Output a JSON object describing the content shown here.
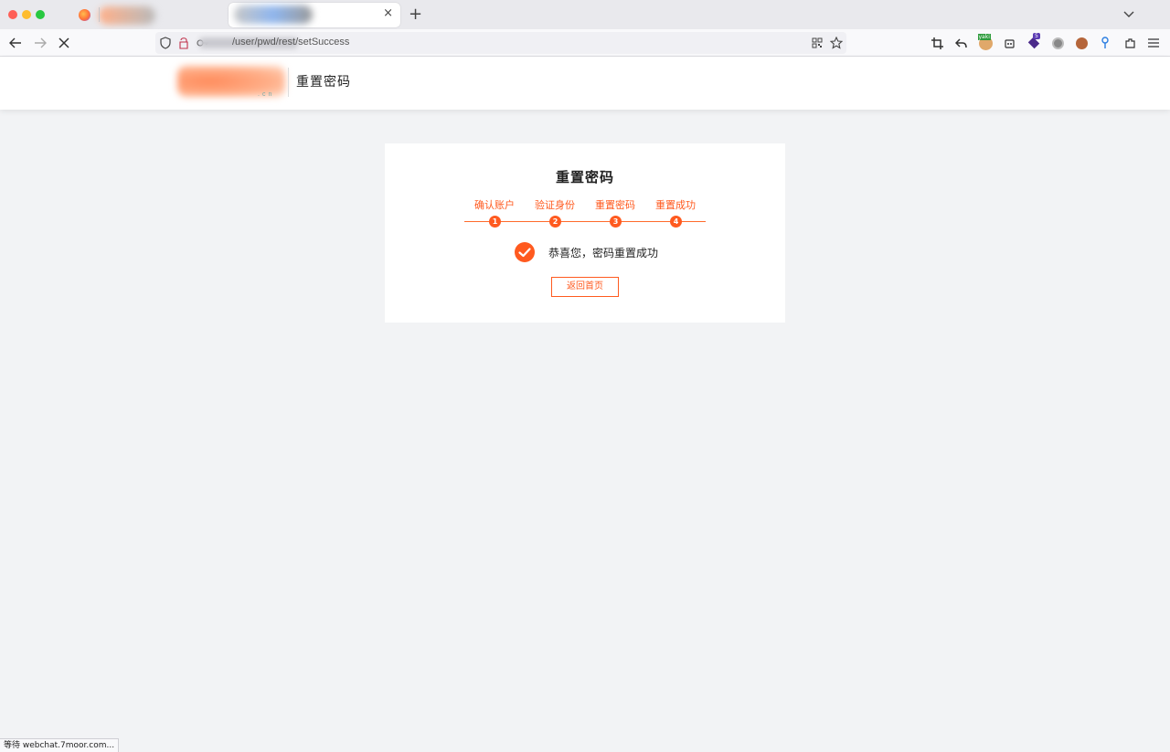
{
  "browser": {
    "url_path": "/user/pwd/rest/setSuccess",
    "tab_close": "×",
    "new_tab": "+",
    "badges": {
      "yaki": "yaki",
      "count": "5"
    },
    "status": "等待 webchat.7moor.com..."
  },
  "header": {
    "title": "重置密码",
    "logo_suffix": ".cn"
  },
  "card": {
    "title": "重置密码",
    "steps": [
      {
        "label": "确认账户",
        "number": "1"
      },
      {
        "label": "验证身份",
        "number": "2"
      },
      {
        "label": "重置密码",
        "number": "3"
      },
      {
        "label": "重置成功",
        "number": "4"
      }
    ],
    "success_message": "恭喜您，密码重置成功",
    "home_button": "返回首页"
  },
  "colors": {
    "accent": "#ff5a1f",
    "page_bg": "#f2f3f5"
  }
}
